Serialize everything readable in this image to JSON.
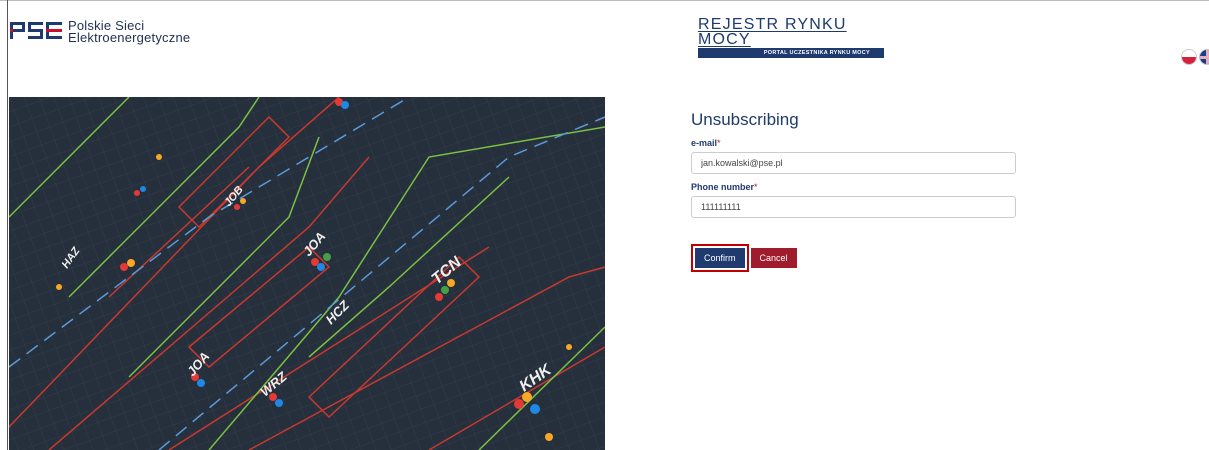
{
  "header": {
    "logo_mark": "PSE",
    "company_line1": "Polskie Sieci",
    "company_line2": "Elektroenergetyczne",
    "registry_title": "REJESTR RYNKU MOCY",
    "registry_subtitle": "PORTAL UCZESTNIKA RYNKU MOCY"
  },
  "languages": [
    {
      "code": "pl",
      "icon": "poland-flag-icon"
    },
    {
      "code": "en",
      "icon": "uk-flag-icon"
    }
  ],
  "hero": {
    "labels": [
      "TCN",
      "HCZ",
      "WRZ",
      "KHK",
      "JOA",
      "JOA",
      "JOB",
      "HAZ"
    ]
  },
  "form": {
    "title": "Unsubscribing",
    "email_label": "e-mail",
    "email_value": "jan.kowalski@pse.pl",
    "phone_label": "Phone number",
    "phone_value": "111111111",
    "required_mark": "*",
    "confirm_label": "Confirm",
    "cancel_label": "Cancel"
  },
  "colors": {
    "brand_navy": "#1e3a6e",
    "cancel_red": "#a01b2b",
    "highlight_red": "#c00000"
  }
}
